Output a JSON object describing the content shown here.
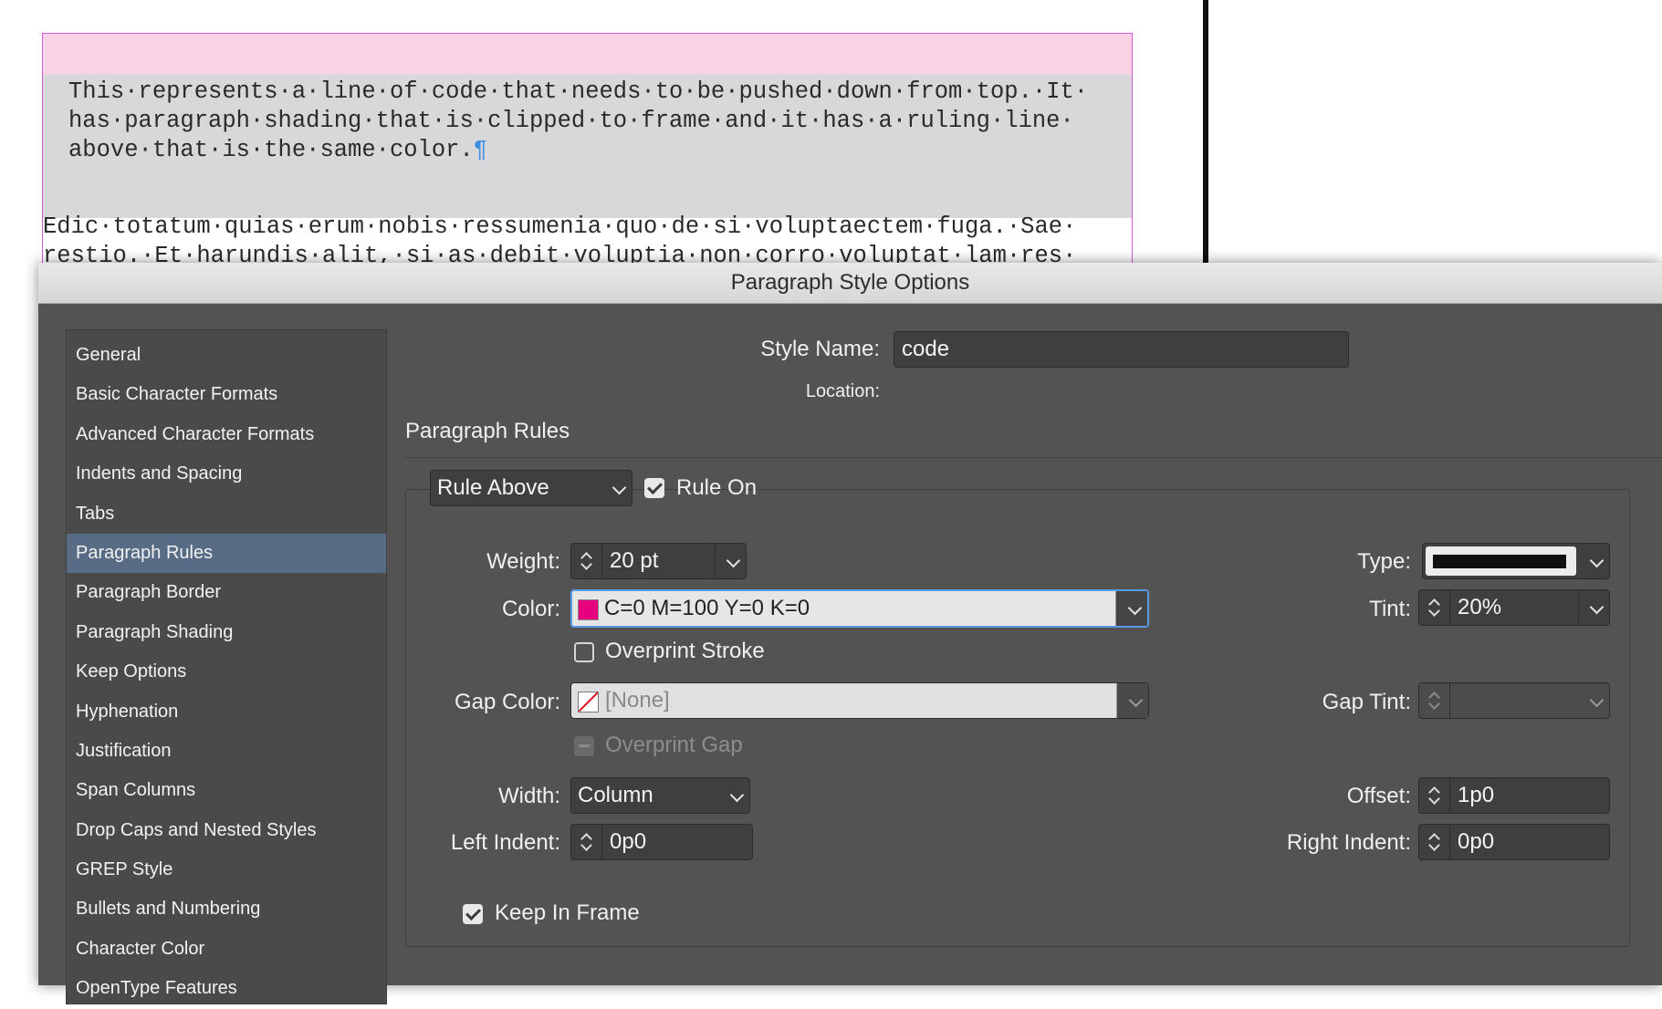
{
  "document": {
    "code_paragraph": "This·represents·a·line·of·code·that·needs·to·be·pushed·down·from·top.·It·\nhas·paragraph·shading·that·is·clipped·to·frame·and·it·has·a·ruling·line·\nabove·that·is·the·same·color.",
    "pilcrow": "¶",
    "body_paragraph": "Edic·totatum·quias·erum·nobis·ressumenia·quo·de·si·voluptaectem·fuga.·Sae·\nrestio.·Et·harundis·alit,·si·as·debit·voluptia·non·corro·voluptat·lam·res·",
    "rule_color": "#f8d3e6",
    "shading_color": "#d8d8db",
    "frame_color": "#d45cd8"
  },
  "dialog": {
    "title": "Paragraph Style Options",
    "categories": [
      "General",
      "Basic Character Formats",
      "Advanced Character Formats",
      "Indents and Spacing",
      "Tabs",
      "Paragraph Rules",
      "Paragraph Border",
      "Paragraph Shading",
      "Keep Options",
      "Hyphenation",
      "Justification",
      "Span Columns",
      "Drop Caps and Nested Styles",
      "GREP Style",
      "Bullets and Numbering",
      "Character Color",
      "OpenType Features"
    ],
    "selected_category": "Paragraph Rules",
    "style_name_label": "Style Name:",
    "style_name_value": "code",
    "location_label": "Location:",
    "section_title": "Paragraph Rules",
    "rule_select": "Rule Above",
    "rule_on_label": "Rule On",
    "rule_on_checked": true,
    "weight_label": "Weight:",
    "weight_value": "20 pt",
    "type_label": "Type:",
    "color_label": "Color:",
    "color_value": "C=0 M=100 Y=0 K=0",
    "color_swatch": "#e6007e",
    "tint_label": "Tint:",
    "tint_value": "20%",
    "overprint_stroke_label": "Overprint Stroke",
    "overprint_stroke_checked": false,
    "gap_color_label": "Gap Color:",
    "gap_color_value": "[None]",
    "gap_tint_label": "Gap Tint:",
    "overprint_gap_label": "Overprint Gap",
    "width_label": "Width:",
    "width_value": "Column",
    "offset_label": "Offset:",
    "offset_value": "1p0",
    "left_indent_label": "Left Indent:",
    "left_indent_value": "0p0",
    "right_indent_label": "Right Indent:",
    "right_indent_value": "0p0",
    "keep_in_frame_label": "Keep In Frame",
    "keep_in_frame_checked": true
  }
}
